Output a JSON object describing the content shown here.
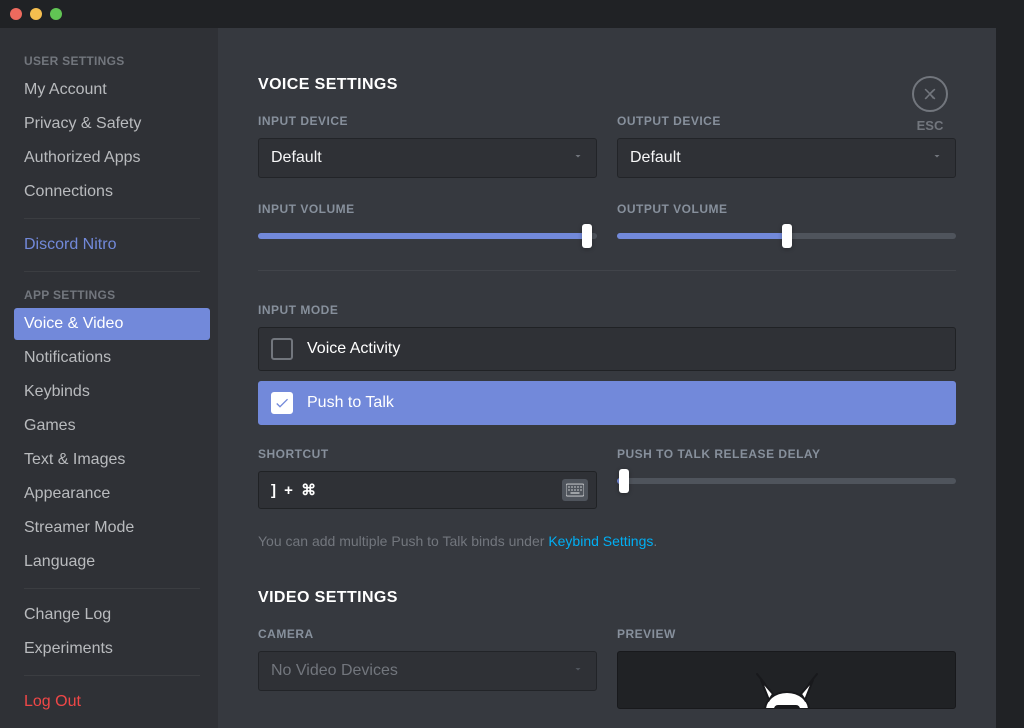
{
  "sidebar": {
    "userSettingsHeader": "User Settings",
    "userItems": [
      {
        "label": "My Account"
      },
      {
        "label": "Privacy & Safety"
      },
      {
        "label": "Authorized Apps"
      },
      {
        "label": "Connections"
      }
    ],
    "nitroLabel": "Discord Nitro",
    "appSettingsHeader": "App Settings",
    "appItems": [
      {
        "label": "Voice & Video",
        "selected": true
      },
      {
        "label": "Notifications"
      },
      {
        "label": "Keybinds"
      },
      {
        "label": "Games"
      },
      {
        "label": "Text & Images"
      },
      {
        "label": "Appearance"
      },
      {
        "label": "Streamer Mode"
      },
      {
        "label": "Language"
      }
    ],
    "changeLog": "Change Log",
    "experiments": "Experiments",
    "logout": "Log Out"
  },
  "esc": {
    "label": "ESC"
  },
  "voice": {
    "title": "Voice Settings",
    "inputDeviceLabel": "Input Device",
    "inputDeviceValue": "Default",
    "outputDeviceLabel": "Output Device",
    "outputDeviceValue": "Default",
    "inputVolumeLabel": "Input Volume",
    "inputVolumePct": 97,
    "outputVolumeLabel": "Output Volume",
    "outputVolumePct": 50,
    "inputModeLabel": "Input Mode",
    "voiceActivityLabel": "Voice Activity",
    "pushToTalkLabel": "Push to Talk",
    "shortcutLabel": "Shortcut",
    "shortcutValue": "] + ⌘",
    "releaseDelayLabel": "Push To Talk Release Delay",
    "releaseDelayPct": 2,
    "noteText": "You can add multiple Push to Talk binds under ",
    "noteLink": "Keybind Settings",
    "notePeriod": "."
  },
  "video": {
    "title": "Video Settings",
    "cameraLabel": "Camera",
    "cameraValue": "No Video Devices",
    "previewLabel": "Preview"
  }
}
